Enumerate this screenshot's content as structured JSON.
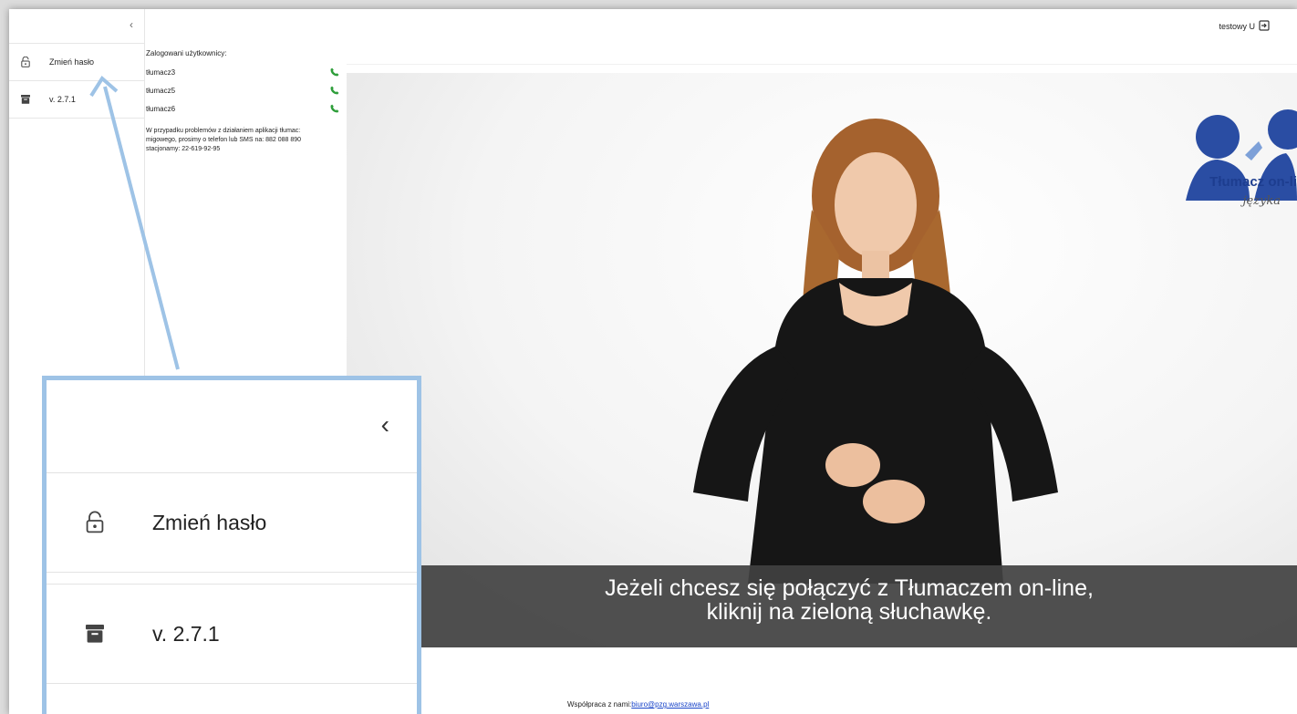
{
  "header": {
    "username": "testowy U"
  },
  "sidebar": {
    "items": [
      {
        "label": "Zmień hasło",
        "icon": "lock-open-icon"
      },
      {
        "label": "v. 2.7.1",
        "icon": "archive-icon"
      }
    ]
  },
  "users": {
    "title": "Zalogowani użytkownicy:",
    "list": [
      "tłumacz3",
      "tłumacz5",
      "tłumacz6"
    ],
    "info_lines": [
      "W przypadku problemów z działaniem aplikacji tłumac:",
      "migowego, prosimy o telefon lub SMS na: 882 088 890",
      "stacjonamy: 22-619-92-95"
    ]
  },
  "video": {
    "subtitle_line1": "Jeżeli chcesz się połączyć z Tłumaczem on-line,",
    "subtitle_line2": "kliknij na zieloną słuchawkę.",
    "logo_title": "Tłumacz on-li",
    "logo_sub": "języka"
  },
  "footer": {
    "label": "Współpraca z nami:",
    "email": "biuro@pzg.warszawa.pl"
  },
  "colors": {
    "phone_green": "#2e9e3a",
    "highlight_blue": "#9ec3e6",
    "link_blue": "#1a45c9",
    "logo_blue": "#1d3d8f"
  }
}
